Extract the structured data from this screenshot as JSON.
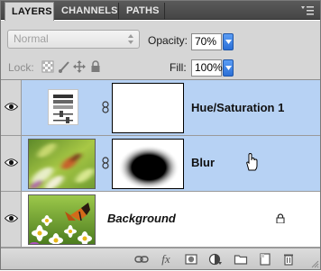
{
  "tabs": [
    {
      "label": "LAYERS",
      "active": true
    },
    {
      "label": "CHANNELS",
      "active": false
    },
    {
      "label": "PATHS",
      "active": false
    }
  ],
  "controls": {
    "blend_mode": "Normal",
    "opacity_label": "Opacity:",
    "opacity_value": "70%",
    "lock_label": "Lock:",
    "fill_label": "Fill:",
    "fill_value": "100%"
  },
  "layers": [
    {
      "name": "Hue/Saturation 1",
      "type": "adjustment",
      "selected": true,
      "visible": true
    },
    {
      "name": "Blur",
      "type": "pixel-with-mask",
      "selected": true,
      "visible": true
    },
    {
      "name": "Background",
      "type": "background",
      "selected": false,
      "visible": true,
      "locked": true
    }
  ],
  "bottom_toolbar": [
    "link-layers-icon",
    "fx-icon",
    "add-mask-icon",
    "adjustment-layer-icon",
    "new-group-icon",
    "new-layer-icon",
    "trash-icon"
  ],
  "bottom_toolbar_fx_label": "fx",
  "colors": {
    "selection": "#b7d2f4",
    "panel_bg": "#d6d6d6",
    "tab_bar": "#4a4a4a",
    "stepper_blue": "#2b6fd6"
  }
}
